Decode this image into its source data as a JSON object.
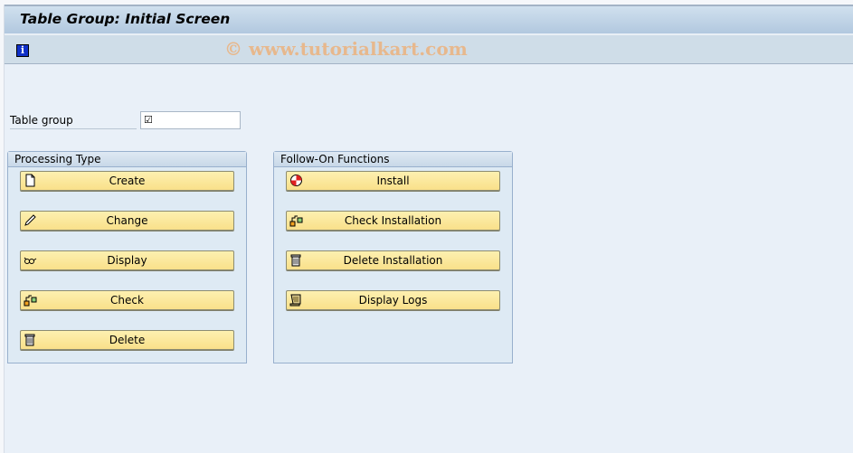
{
  "window": {
    "title": "Table Group: Initial Screen"
  },
  "toolbar": {
    "info_icon": "info-icon",
    "info_glyph": "i",
    "watermark": "© www.tutorialkart.com"
  },
  "form": {
    "table_group_label": "Table group",
    "table_group_value": "",
    "table_group_required_glyph": "☑"
  },
  "processing_type": {
    "title": "Processing Type",
    "buttons": [
      {
        "label": "Create",
        "icon": "new-document-icon"
      },
      {
        "label": "Change",
        "icon": "pencil-icon"
      },
      {
        "label": "Display",
        "icon": "glasses-icon"
      },
      {
        "label": "Check",
        "icon": "hierarchy-check-icon"
      },
      {
        "label": "Delete",
        "icon": "trash-icon"
      }
    ]
  },
  "follow_on_functions": {
    "title": "Follow-On Functions",
    "buttons": [
      {
        "label": "Install",
        "icon": "install-icon"
      },
      {
        "label": "Check Installation",
        "icon": "hierarchy-check-icon"
      },
      {
        "label": "Delete Installation",
        "icon": "trash-icon"
      },
      {
        "label": "Display Logs",
        "icon": "log-scroll-icon"
      }
    ]
  }
}
